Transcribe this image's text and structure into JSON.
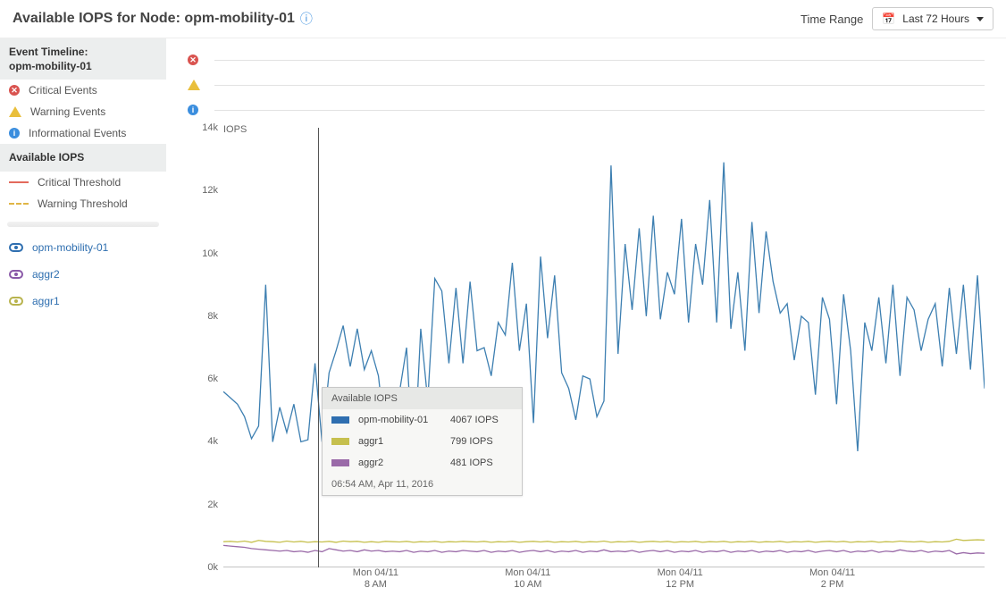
{
  "title_prefix": "Available IOPS for Node: ",
  "title_node": "opm-mobility-01",
  "time_range_label": "Time Range",
  "time_range_value": "Last 72 Hours",
  "event_timeline_label": "Event Timeline:",
  "event_timeline_node": "opm-mobility-01",
  "legend": {
    "critical": "Critical Events",
    "warning": "Warning Events",
    "info": "Informational Events"
  },
  "avail_iops_header": "Available IOPS",
  "threshold_labels": {
    "critical": "Critical Threshold",
    "warning": "Warning Threshold"
  },
  "objects": [
    {
      "name": "opm-mobility-01",
      "color": "blue"
    },
    {
      "name": "aggr2",
      "color": "purple"
    },
    {
      "name": "aggr1",
      "color": "olive"
    }
  ],
  "tooltip": {
    "header": "Available IOPS",
    "rows": [
      {
        "name": "opm-mobility-01",
        "value": "4067 IOPS",
        "swatch": "sw-blue"
      },
      {
        "name": "aggr1",
        "value": "799 IOPS",
        "swatch": "sw-olive"
      },
      {
        "name": "aggr2",
        "value": "481 IOPS",
        "swatch": "sw-purple"
      }
    ],
    "time": "06:54 AM, Apr 11, 2016"
  },
  "chart_data": {
    "type": "line",
    "title": "Available IOPS for Node: opm-mobility-01",
    "ylabel": "IOPS",
    "ylim": [
      0,
      14000
    ],
    "yticks": [
      0,
      2000,
      4000,
      6000,
      8000,
      10000,
      12000,
      14000
    ],
    "ytick_labels": [
      "0k",
      "2k",
      "4k",
      "6k",
      "8k",
      "10k",
      "12k",
      "14k"
    ],
    "x_categories": [
      "Mon 04/11 8 AM",
      "Mon 04/11 10 AM",
      "Mon 04/11 12 PM",
      "Mon 04/11 2 PM"
    ],
    "x_tick_positions_pct": [
      20,
      40,
      60,
      80
    ],
    "cursor_x_pct": 12.5,
    "series": [
      {
        "name": "opm-mobility-01",
        "color": "#3d7fb1",
        "values": [
          5600,
          5400,
          5200,
          4800,
          4100,
          4500,
          9000,
          4000,
          5100,
          4300,
          5200,
          4000,
          4067,
          6500,
          4000,
          6200,
          6900,
          7700,
          6400,
          7600,
          6300,
          6900,
          6100,
          4100,
          4400,
          5600,
          7000,
          3000,
          7600,
          5300,
          9200,
          8800,
          6500,
          8900,
          6500,
          9100,
          6900,
          7000,
          6100,
          7800,
          7400,
          9700,
          6900,
          8400,
          4600,
          9900,
          7300,
          9300,
          6200,
          5700,
          4700,
          6100,
          6000,
          4800,
          5300,
          12800,
          6800,
          10300,
          8200,
          10800,
          8000,
          11200,
          7900,
          9400,
          8700,
          11100,
          7800,
          10300,
          9000,
          11700,
          7800,
          12900,
          7600,
          9400,
          6900,
          11000,
          8100,
          10700,
          9100,
          8100,
          8400,
          6600,
          8000,
          7800,
          5500,
          8600,
          7900,
          5200,
          8700,
          6900,
          3700,
          7800,
          6900,
          8600,
          6500,
          9000,
          6100,
          8600,
          8200,
          6900,
          7900,
          8400,
          6400,
          8900,
          6800,
          9000,
          6300,
          9300,
          5700
        ]
      },
      {
        "name": "aggr1",
        "color": "#c6c04e",
        "values": [
          820,
          830,
          810,
          840,
          800,
          860,
          830,
          820,
          800,
          840,
          810,
          830,
          799,
          820,
          810,
          830,
          800,
          840,
          820,
          830,
          800,
          820,
          800,
          830,
          820,
          810,
          830,
          800,
          820,
          810,
          830,
          800,
          820,
          810,
          830,
          820,
          810,
          830,
          800,
          820,
          810,
          830,
          800,
          820,
          830,
          810,
          830,
          800,
          820,
          810,
          830,
          800,
          820,
          810,
          840,
          800,
          820,
          810,
          830,
          800,
          820,
          830,
          810,
          830,
          800,
          820,
          810,
          830,
          800,
          820,
          810,
          830,
          800,
          820,
          810,
          830,
          800,
          820,
          810,
          830,
          800,
          820,
          810,
          830,
          800,
          820,
          830,
          810,
          830,
          800,
          820,
          810,
          830,
          800,
          820,
          810,
          840,
          820,
          810,
          830,
          800,
          820,
          810,
          830,
          900,
          860,
          870,
          880,
          870
        ]
      },
      {
        "name": "aggr2",
        "color": "#9a6aa8",
        "values": [
          700,
          680,
          660,
          640,
          600,
          580,
          560,
          540,
          520,
          540,
          500,
          520,
          481,
          540,
          500,
          600,
          560,
          520,
          540,
          500,
          560,
          520,
          540,
          500,
          520,
          500,
          540,
          480,
          520,
          500,
          540,
          480,
          520,
          500,
          540,
          520,
          500,
          540,
          480,
          520,
          500,
          540,
          480,
          520,
          540,
          500,
          540,
          480,
          520,
          500,
          540,
          480,
          520,
          500,
          560,
          500,
          520,
          500,
          540,
          480,
          520,
          540,
          500,
          540,
          480,
          520,
          500,
          540,
          480,
          520,
          500,
          540,
          480,
          520,
          500,
          540,
          480,
          520,
          500,
          540,
          480,
          520,
          500,
          540,
          480,
          520,
          540,
          500,
          540,
          480,
          520,
          500,
          540,
          480,
          520,
          500,
          560,
          520,
          500,
          540,
          480,
          520,
          500,
          540,
          430,
          470,
          440,
          460,
          450
        ]
      }
    ]
  }
}
